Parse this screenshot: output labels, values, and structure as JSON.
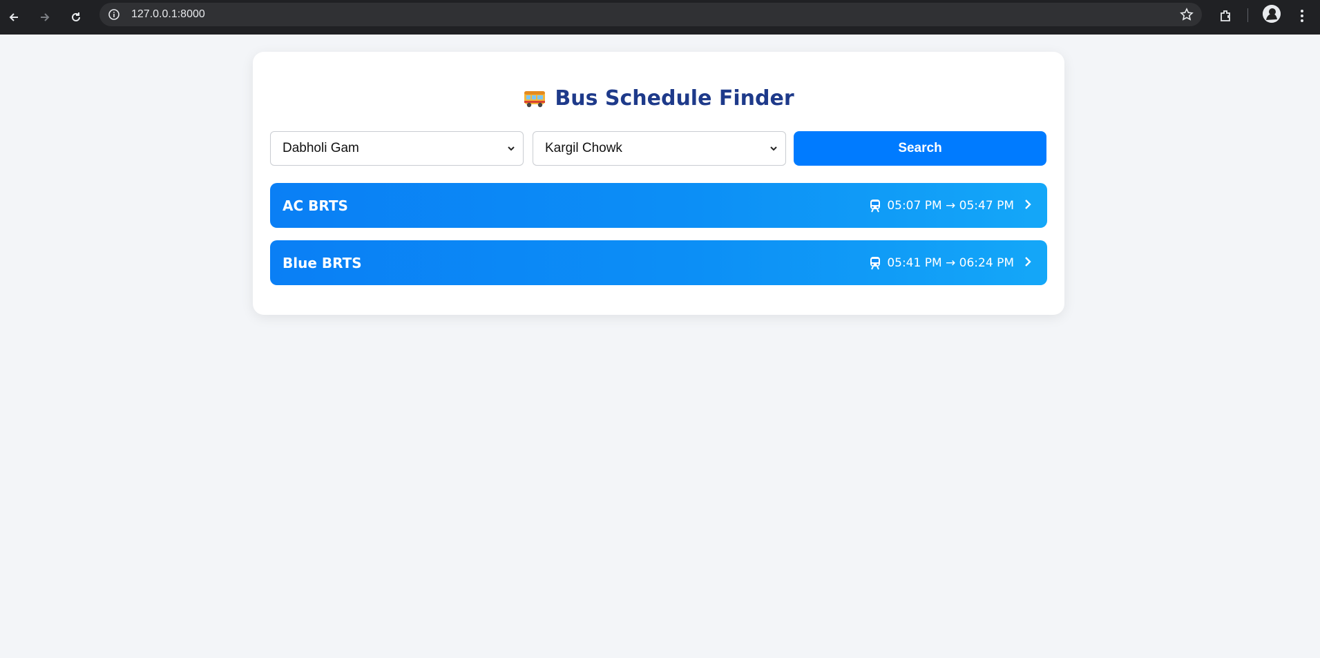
{
  "browser": {
    "url": "127.0.0.1:8000"
  },
  "app": {
    "title": "Bus Schedule Finder",
    "title_icon": "bus-icon",
    "from_select": {
      "value": "Dabholi Gam"
    },
    "to_select": {
      "value": "Kargil Chowk"
    },
    "search_label": "Search",
    "routes": [
      {
        "name": "AC BRTS",
        "time": "05:07 PM → 05:47 PM",
        "icon": "tram-icon"
      },
      {
        "name": "Blue BRTS",
        "time": "05:41 PM → 06:24 PM",
        "icon": "tram-icon"
      }
    ]
  },
  "colors": {
    "title": "#1e3a8a",
    "primary": "#007bff",
    "route_gradient_start": "#0a7ff5",
    "route_gradient_end": "#14a7f8",
    "background": "#f3f5f8"
  }
}
